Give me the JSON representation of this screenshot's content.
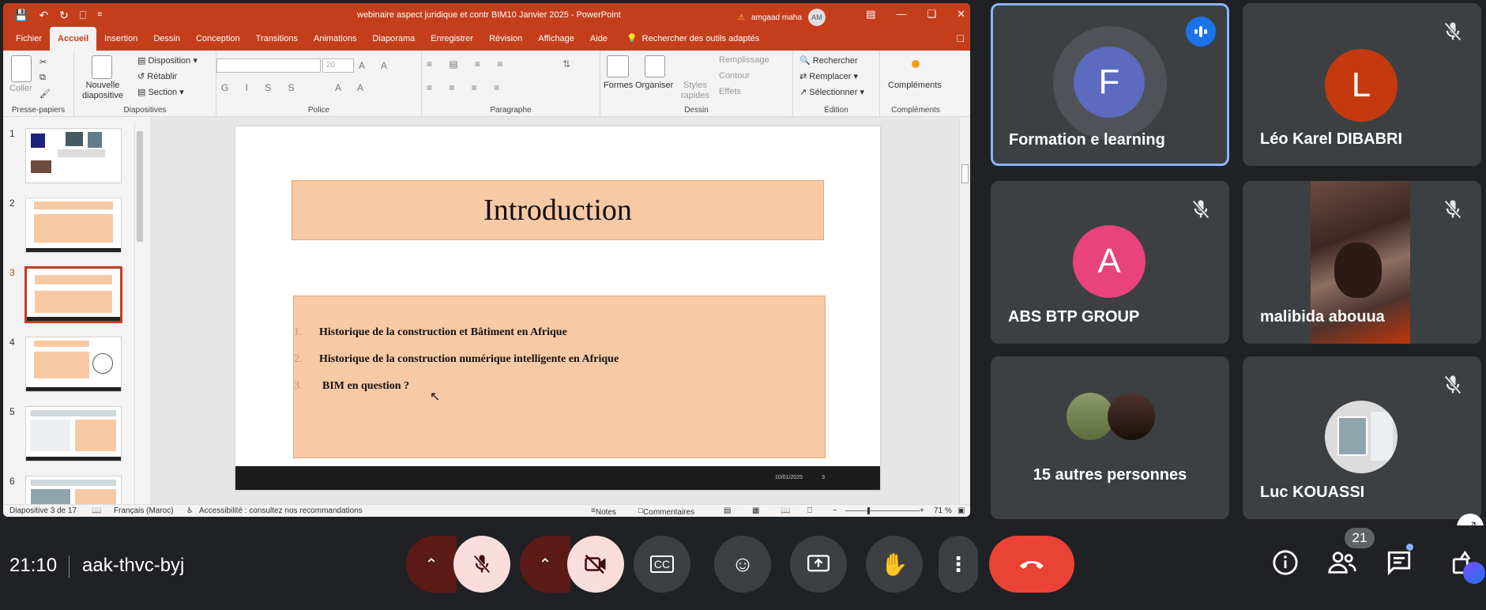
{
  "ppt": {
    "window_title": "webinaire aspect juridique et contr BIM10 Janvier 2025  -  PowerPoint",
    "user_name": "amgaad maha",
    "user_initials": "AM",
    "tabs": [
      "Fichier",
      "Accueil",
      "Insertion",
      "Dessin",
      "Conception",
      "Transitions",
      "Animations",
      "Diaporama",
      "Enregistrer",
      "Révision",
      "Affichage",
      "Aide"
    ],
    "search_label": "Rechercher des outils adaptés",
    "ribbon": {
      "coller": "Coller",
      "presse_papiers": "Presse-papiers",
      "nouvelle_diapositive": "Nouvelle diapositive",
      "disposition": "Disposition",
      "retablir": "Rétablir",
      "section": "Section",
      "diapositives": "Diapositives",
      "font_size": "20",
      "police": "Police",
      "paragraphe": "Paragraphe",
      "formes": "Formes",
      "organiser": "Organiser",
      "styles_rapides": "Styles rapides",
      "remplissage": "Remplissage",
      "contour": "Contour",
      "effets": "Effets",
      "dessin": "Dessin",
      "rechercher": "Rechercher",
      "remplacer": "Remplacer",
      "selectionner": "Sélectionner",
      "edition": "Édition",
      "complements": "Compléments",
      "complements_group": "Compléments"
    },
    "thumbnails": [
      {
        "num": "1"
      },
      {
        "num": "2"
      },
      {
        "num": "3"
      },
      {
        "num": "4"
      },
      {
        "num": "5"
      },
      {
        "num": "6"
      }
    ],
    "slide": {
      "title": "Introduction",
      "bullets": [
        {
          "num": "1.",
          "text": "Historique de la construction et Bâtiment en Afrique"
        },
        {
          "num": "2.",
          "text": "Historique de la construction numérique intelligente en Afrique"
        },
        {
          "num": "3.",
          "text": "BIM en question ?"
        }
      ],
      "footer_date": "10/01/2025",
      "footer_page": "3"
    },
    "status": {
      "slide_counter": "Diapositive 3 de 17",
      "language": "Français (Maroc)",
      "accessibility": "Accessibilité : consultez nos recommandations",
      "notes": "Notes",
      "comments": "Commentaires",
      "zoom": "71 %"
    }
  },
  "meet": {
    "participants": [
      {
        "name": "Formation e learning",
        "initial": "F",
        "color": "#5c6bc0"
      },
      {
        "name": "Léo Karel DIBABRI",
        "initial": "L",
        "color": "#c5390f"
      },
      {
        "name": "ABS BTP GROUP",
        "initial": "A",
        "color": "#e8437a"
      },
      {
        "name": "malibida abouua",
        "initial": "",
        "color": ""
      },
      {
        "name": "15 autres personnes",
        "initial": "",
        "color": ""
      },
      {
        "name": "Luc KOUASSI",
        "initial": "",
        "color": ""
      }
    ],
    "time": "21:10",
    "meeting_code": "aak-thvc-byj",
    "participants_count": "21"
  }
}
